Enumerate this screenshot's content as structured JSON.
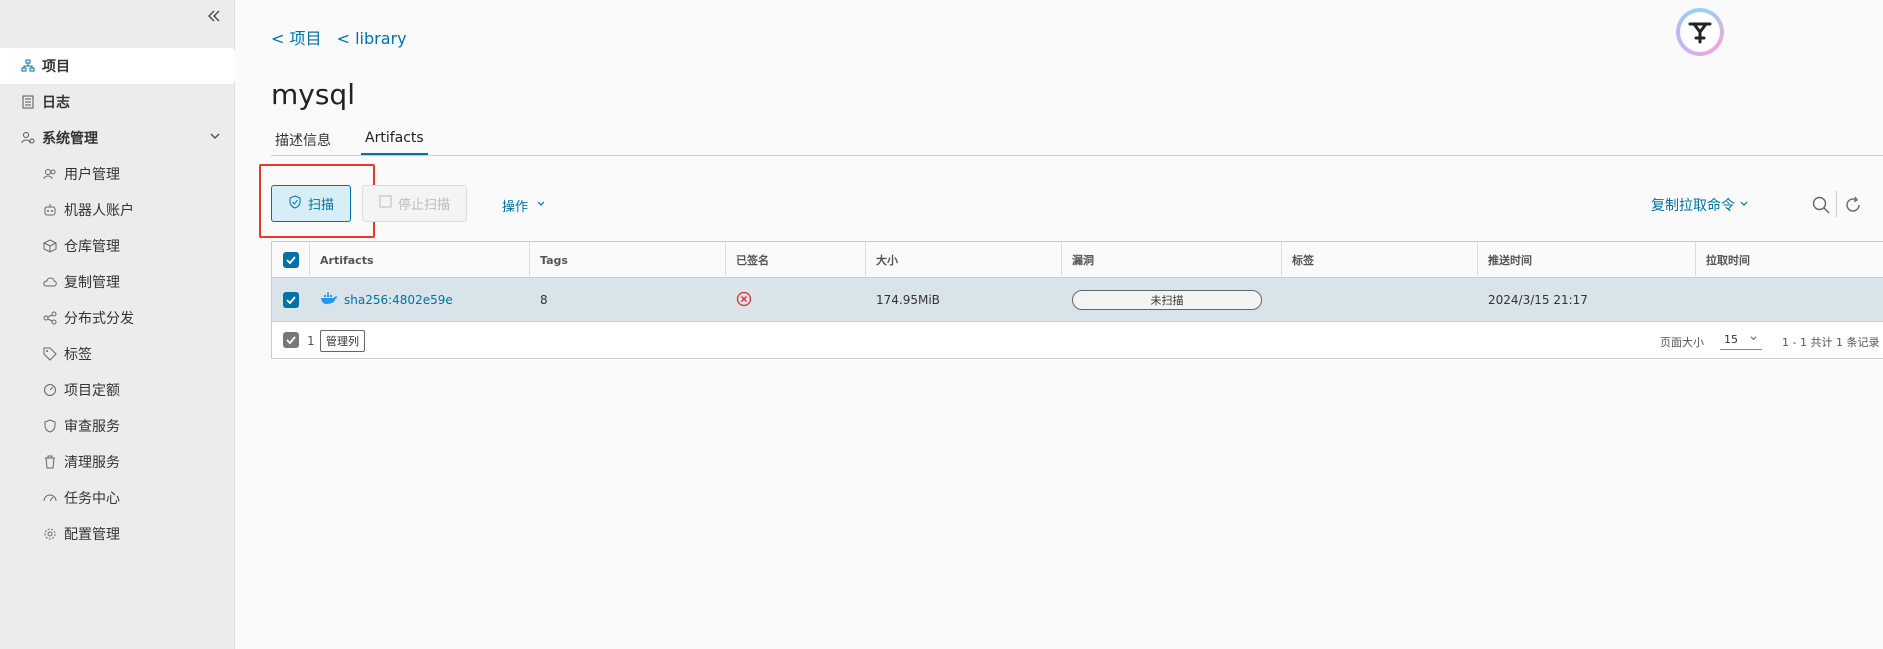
{
  "sidebar": {
    "items": [
      {
        "label": "项目",
        "icon": "project-icon"
      },
      {
        "label": "日志",
        "icon": "log-icon"
      },
      {
        "label": "系统管理",
        "icon": "admin-icon"
      }
    ],
    "sub_items": [
      {
        "label": "用户管理"
      },
      {
        "label": "机器人账户"
      },
      {
        "label": "仓库管理"
      },
      {
        "label": "复制管理"
      },
      {
        "label": "分布式分发"
      },
      {
        "label": "标签"
      },
      {
        "label": "项目定额"
      },
      {
        "label": "审查服务"
      },
      {
        "label": "清理服务"
      },
      {
        "label": "任务中心"
      },
      {
        "label": "配置管理"
      }
    ]
  },
  "breadcrumb": {
    "project": "< 项目",
    "library": "< library"
  },
  "page_title": "mysql",
  "tabs": [
    {
      "label": "描述信息"
    },
    {
      "label": "Artifacts"
    }
  ],
  "toolbar": {
    "scan_label": "扫描",
    "stop_scan_label": "停止扫描",
    "ops_label": "操作",
    "copy_pull_label": "复制拉取命令"
  },
  "table": {
    "headers": [
      "Artifacts",
      "Tags",
      "已签名",
      "大小",
      "漏洞",
      "标签",
      "推送时间",
      "拉取时间"
    ],
    "rows": [
      {
        "digest": "sha256:4802e59e",
        "tags": "8",
        "size": "174.95MiB",
        "vuln": "未扫描",
        "labels": "",
        "push_time": "2024/3/15 21:17",
        "pull_time": ""
      }
    ],
    "footer": {
      "selected_count": "1",
      "manage_cols": "管理列",
      "page_size_label": "页面大小",
      "page_size": "15",
      "page_info": "1 - 1 共计 1 条记录"
    }
  },
  "colors": {
    "accent": "#0072a3",
    "highlight": "#e33b2e",
    "row_selected": "#d8e3ea"
  }
}
